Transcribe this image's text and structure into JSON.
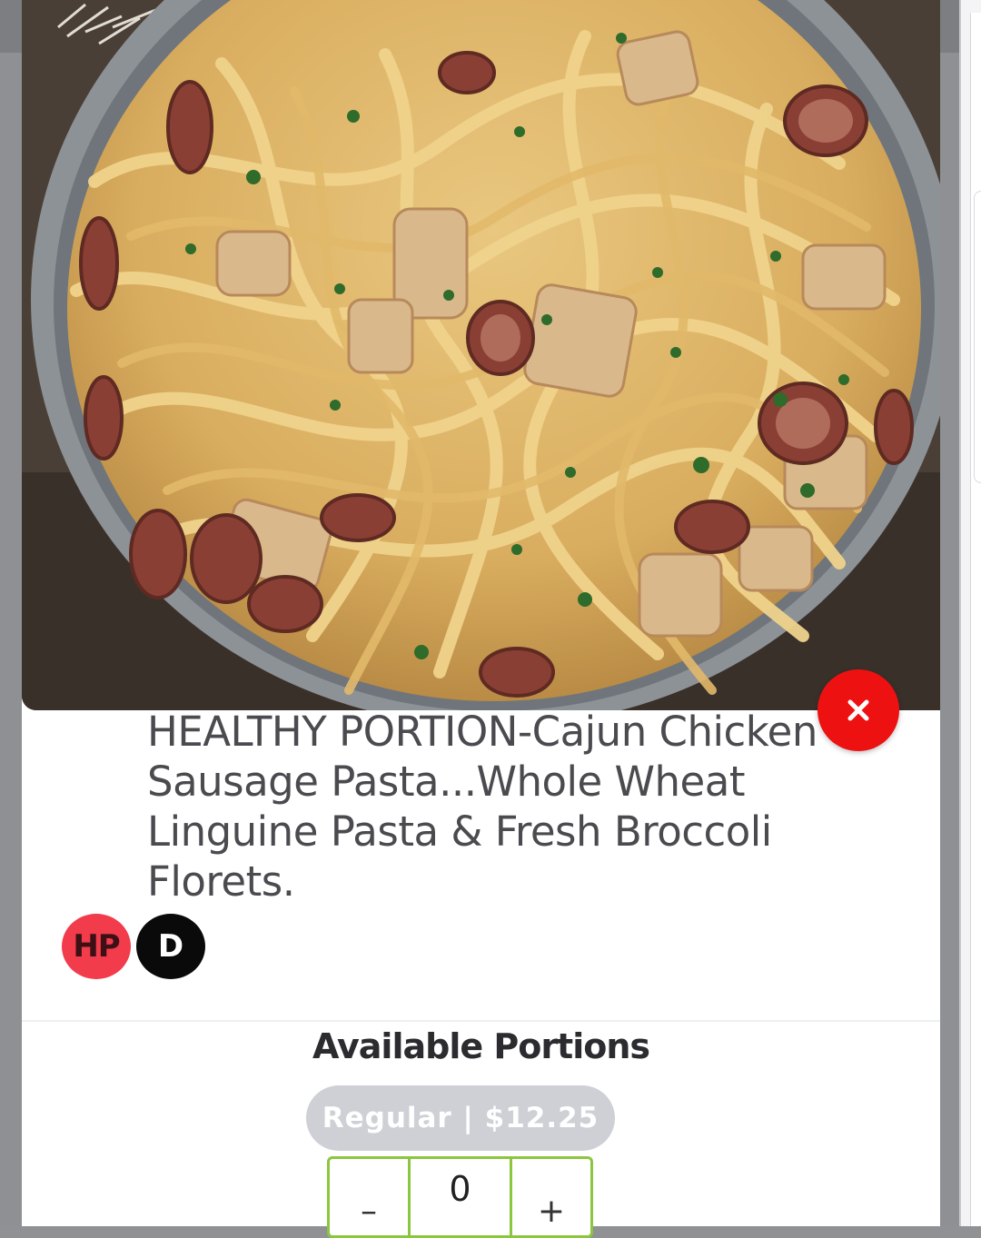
{
  "dish": {
    "image_alt": "Cajun chicken sausage pasta in a skillet",
    "title": "HEALTHY PORTION-Cajun Chicken Sausage Pasta...Whole Wheat Linguine Pasta & Fresh Broccoli Florets."
  },
  "badges": [
    {
      "label": "HP",
      "color": "#f23b4b"
    },
    {
      "label": "D",
      "color": "#0a0a0a"
    }
  ],
  "portions": {
    "heading": "Available Portions",
    "options": [
      {
        "label": "Regular | $12.25"
      }
    ]
  },
  "stepper": {
    "decrement": "–",
    "quantity": "0",
    "increment": "+"
  },
  "colors": {
    "close_button": "#ee1111",
    "stepper_border": "#8cc63f",
    "pill_bg": "#cfd0d5"
  }
}
